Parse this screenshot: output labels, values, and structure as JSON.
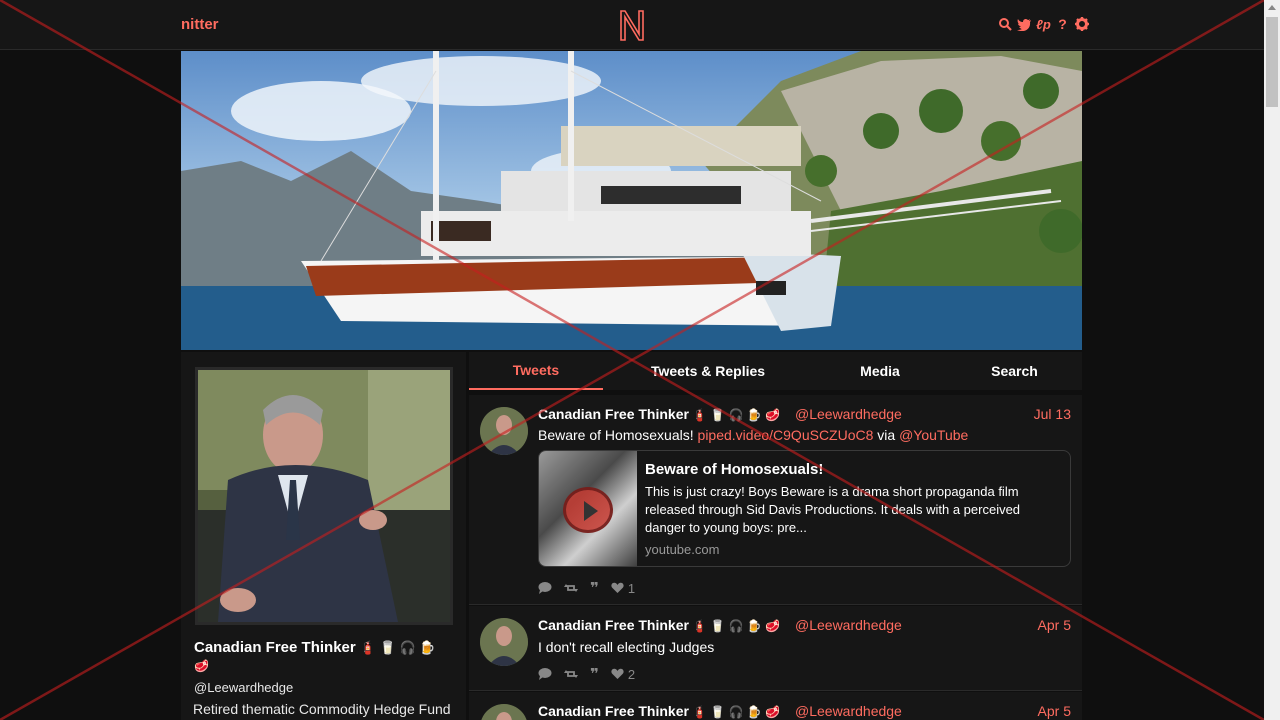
{
  "nav": {
    "brand": "nitter",
    "icons": [
      "search-icon",
      "twitter-icon",
      "rss-icon",
      "help-icon",
      "settings-icon"
    ],
    "icon_glyphs": {
      "search": "⌕",
      "twitter": "🐦",
      "rss": "lp",
      "help": "?",
      "settings": "⚙"
    }
  },
  "colors": {
    "accent": "#ff6c60",
    "background": "#0f0f0f",
    "panel": "#161616",
    "overlay_red": "#c81e1e"
  },
  "profile": {
    "name": "Canadian Free Thinker",
    "name_emoji": "🧯 🥛 🎧 🍺",
    "emoji_line2": "🥩",
    "handle": "@Leewardhedge",
    "bio": "Retired thematic Commodity Hedge Fund"
  },
  "tabs": [
    {
      "label": "Tweets",
      "active": true
    },
    {
      "label": "Tweets & Replies",
      "active": false
    },
    {
      "label": "Media",
      "active": false
    },
    {
      "label": "Search",
      "active": false
    }
  ],
  "tweets": [
    {
      "name": "Canadian Free Thinker",
      "emoji": "🧯 🥛 🎧 🍺 🥩",
      "handle": "@Leewardhedge",
      "date": "Jul 13",
      "text_pre": "Beware of Homosexuals! ",
      "link": "piped.video/C9QuSCZUoC8",
      "text_mid": " via ",
      "mention": "@YouTube",
      "card": {
        "title": "Beware of Homosexuals!",
        "description": "This is just crazy! Boys Beware is a drama short propaganda film released through Sid Davis Productions. It deals with a perceived danger to young boys: pre...",
        "destination": "youtube.com"
      },
      "stats": {
        "replies": "",
        "retweets": "",
        "quotes": "",
        "likes": "1"
      }
    },
    {
      "name": "Canadian Free Thinker",
      "emoji": "🧯 🥛 🎧 🍺 🥩",
      "handle": "@Leewardhedge",
      "date": "Apr 5",
      "text": "I don't recall electing Judges",
      "stats": {
        "replies": "",
        "retweets": "",
        "quotes": "",
        "likes": "2"
      }
    },
    {
      "name": "Canadian Free Thinker",
      "emoji": "🧯 🥛 🎧 🍺 🥩",
      "handle": "@Leewardhedge",
      "date": "Apr 5"
    }
  ]
}
